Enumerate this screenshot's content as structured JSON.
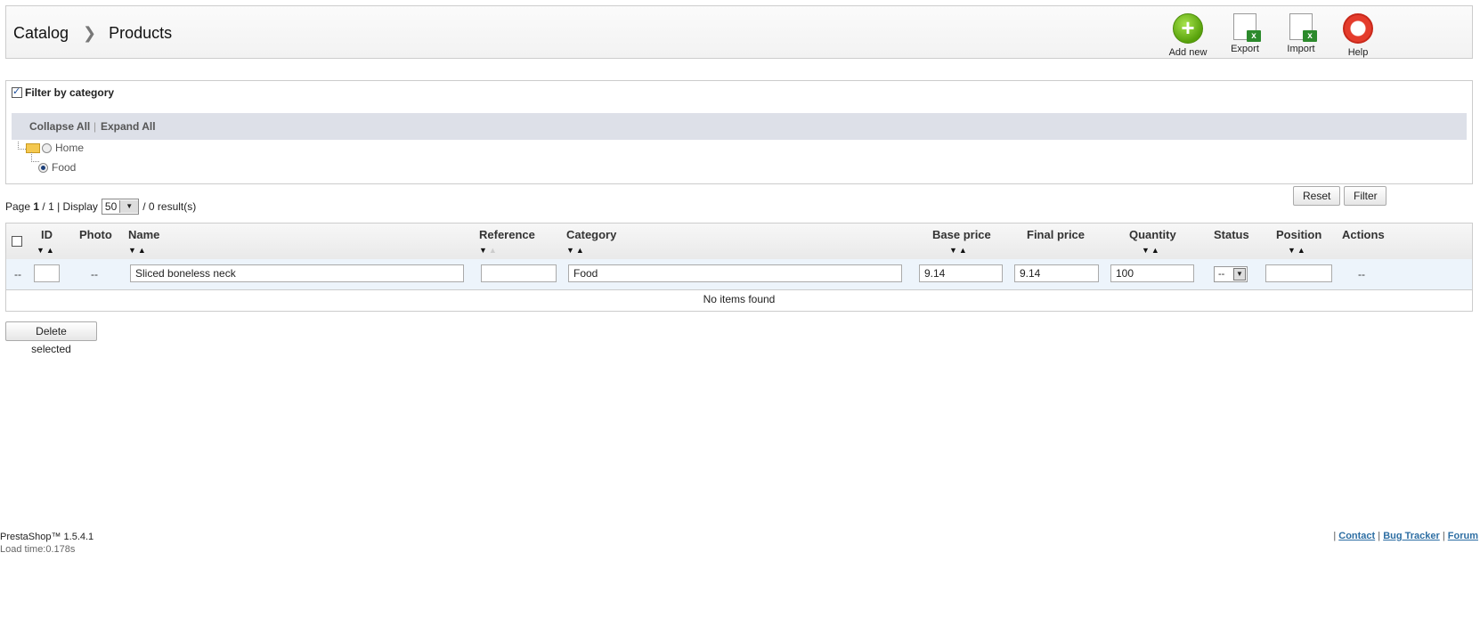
{
  "breadcrumb": {
    "parent": "Catalog",
    "current": "Products"
  },
  "toolbar": {
    "add_new": "Add new",
    "export": "Export",
    "import": "Import",
    "help": "Help"
  },
  "filter": {
    "label": "Filter by category",
    "checked": true,
    "collapse_all": "Collapse All",
    "separator": "|",
    "expand_all": "Expand All",
    "tree": [
      {
        "label": "Home",
        "selected": false
      },
      {
        "label": "Food",
        "selected": true
      }
    ]
  },
  "pager": {
    "page_prefix": "Page",
    "page_current": "1",
    "page_total_text": "/ 1 | Display",
    "per_page": "50",
    "results": "/ 0 result(s)"
  },
  "buttons": {
    "reset": "Reset",
    "filter": "Filter",
    "delete_selected": "Delete selected"
  },
  "table": {
    "headers": {
      "id": "ID",
      "photo": "Photo",
      "name": "Name",
      "reference": "Reference",
      "category": "Category",
      "base_price": "Base price",
      "final_price": "Final price",
      "quantity": "Quantity",
      "status": "Status",
      "position": "Position",
      "actions": "Actions"
    },
    "filters": {
      "select_dash": "--",
      "id": "",
      "photo": "--",
      "name": "Sliced boneless neck",
      "reference": "",
      "category": "Food",
      "base_price": "9.14",
      "final_price": "9.14",
      "quantity": "100",
      "status": "--",
      "position": "",
      "actions": "--"
    },
    "empty_message": "No items found"
  },
  "footer": {
    "version": "PrestaShop™ 1.5.4.1",
    "load_time": "Load time:0.178s",
    "sep": "|",
    "links": [
      "Contact",
      "Bug Tracker",
      "Forum"
    ]
  }
}
